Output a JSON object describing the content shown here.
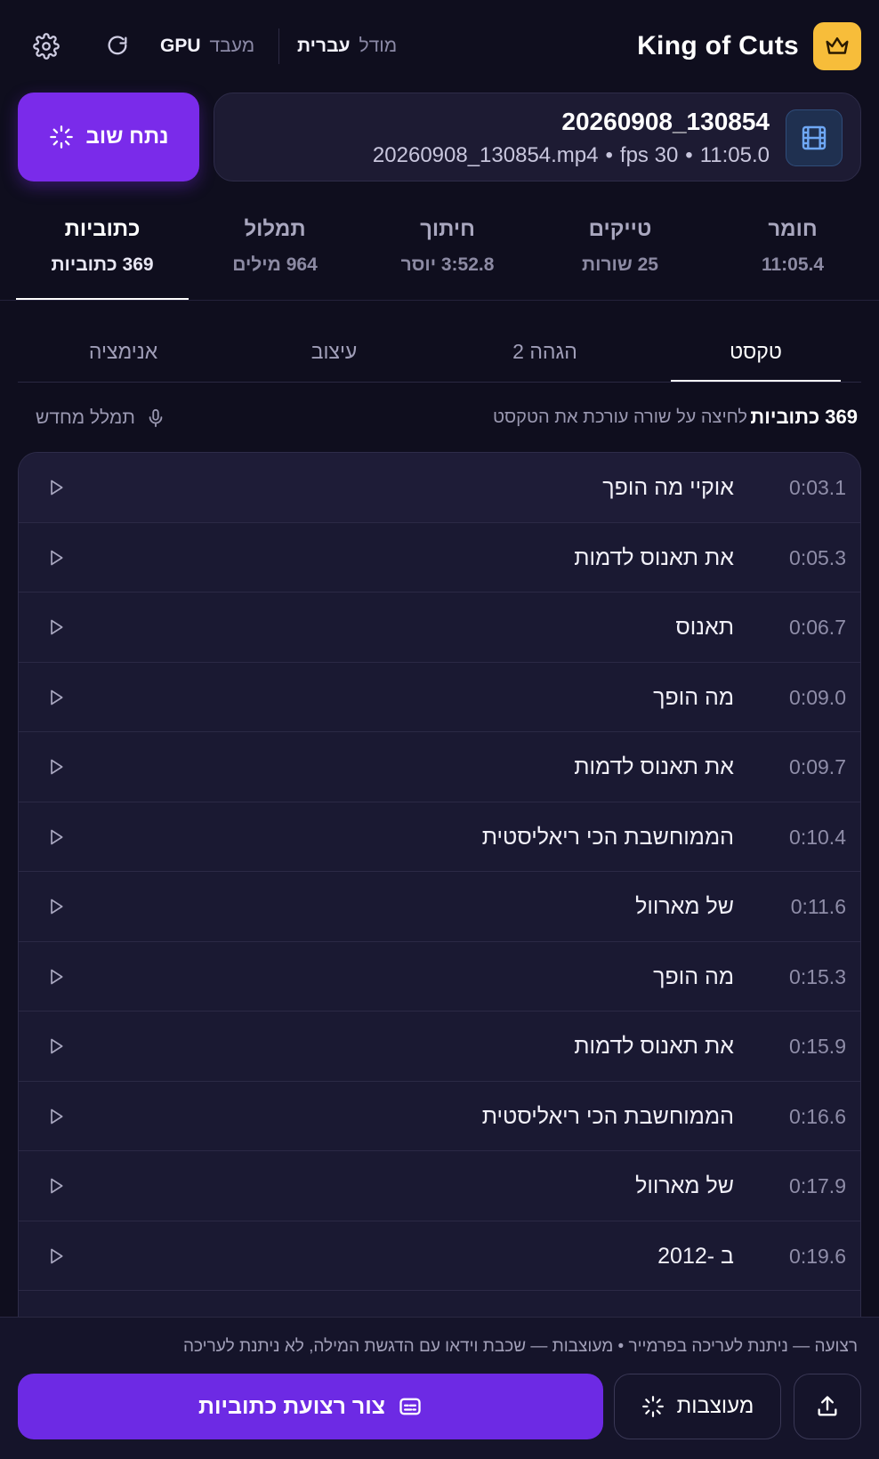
{
  "app": {
    "brand_name": "King of Cuts",
    "icons": {
      "logo": "crown-icon",
      "refresh": "refresh-icon",
      "settings": "gear-icon"
    }
  },
  "header": {
    "model_label": "מודל",
    "model_value": "עברית",
    "processor_label": "מעבד",
    "processor_value": "GPU"
  },
  "file": {
    "title": "20260908_130854",
    "filename": "20260908_130854.mp4",
    "fps": "fps 30",
    "duration": "11:05.0",
    "separator": "•",
    "icon": "film-icon"
  },
  "reanalyze_button": {
    "label": "נתח שוב",
    "icon": "sparkle-icon"
  },
  "stats_tabs": [
    {
      "title": "חומר",
      "value": "11:05.4",
      "active": false
    },
    {
      "title": "טייקים",
      "value": "25 שורות",
      "active": false
    },
    {
      "title": "חיתוך",
      "value": "3:52.8 יוסר",
      "active": false
    },
    {
      "title": "תמלול",
      "value": "964 מילים",
      "active": false
    },
    {
      "title": "כתוביות",
      "value": "369 כתוביות",
      "active": true
    }
  ],
  "sub_tabs": [
    {
      "label": "טקסט",
      "active": true
    },
    {
      "label": "הגהה 2",
      "active": false
    },
    {
      "label": "עיצוב",
      "active": false
    },
    {
      "label": "אנימציה",
      "active": false
    }
  ],
  "subtitles_info": {
    "count": "369 כתוביות",
    "hint": "לחיצה על שורה עורכת את הטקסט",
    "retranscribe_label": "תמלל מחדש",
    "retranscribe_icon": "microphone-icon"
  },
  "subtitles": [
    {
      "time": "0:03.1",
      "text": "אוקיי מה הופך"
    },
    {
      "time": "0:05.3",
      "text": "את תאנוס לדמות"
    },
    {
      "time": "0:06.7",
      "text": "תאנוס"
    },
    {
      "time": "0:09.0",
      "text": "מה הופך"
    },
    {
      "time": "0:09.7",
      "text": "את תאנוס לדמות"
    },
    {
      "time": "0:10.4",
      "text": "הממוחשבת הכי ריאליסטית"
    },
    {
      "time": "0:11.6",
      "text": "של מארוול"
    },
    {
      "time": "0:15.3",
      "text": "מה הופך"
    },
    {
      "time": "0:15.9",
      "text": "את תאנוס לדמות"
    },
    {
      "time": "0:16.6",
      "text": "הממוחשבת הכי ריאליסטית"
    },
    {
      "time": "0:17.9",
      "text": "של מארוול"
    },
    {
      "time": "0:19.6",
      "text": "ב -2012"
    }
  ],
  "footer": {
    "note": "רצועה — ניתנת לעריכה בפרמייר • מעוצבות — שכבת וידאו עם הדגשת המילה, לא ניתנת לעריכה",
    "render_button": {
      "label": "צור רצועת כתוביות",
      "icon": "subtitles-icon"
    },
    "presets_button": {
      "label": "מעוצבות",
      "icon": "sparkle-icon"
    },
    "export_icon": "upload-icon"
  },
  "colors": {
    "background": "#0f0e1e",
    "accent": "#7a2bea",
    "logo_bg": "#f7bd3a",
    "card": "#1d1b33"
  }
}
